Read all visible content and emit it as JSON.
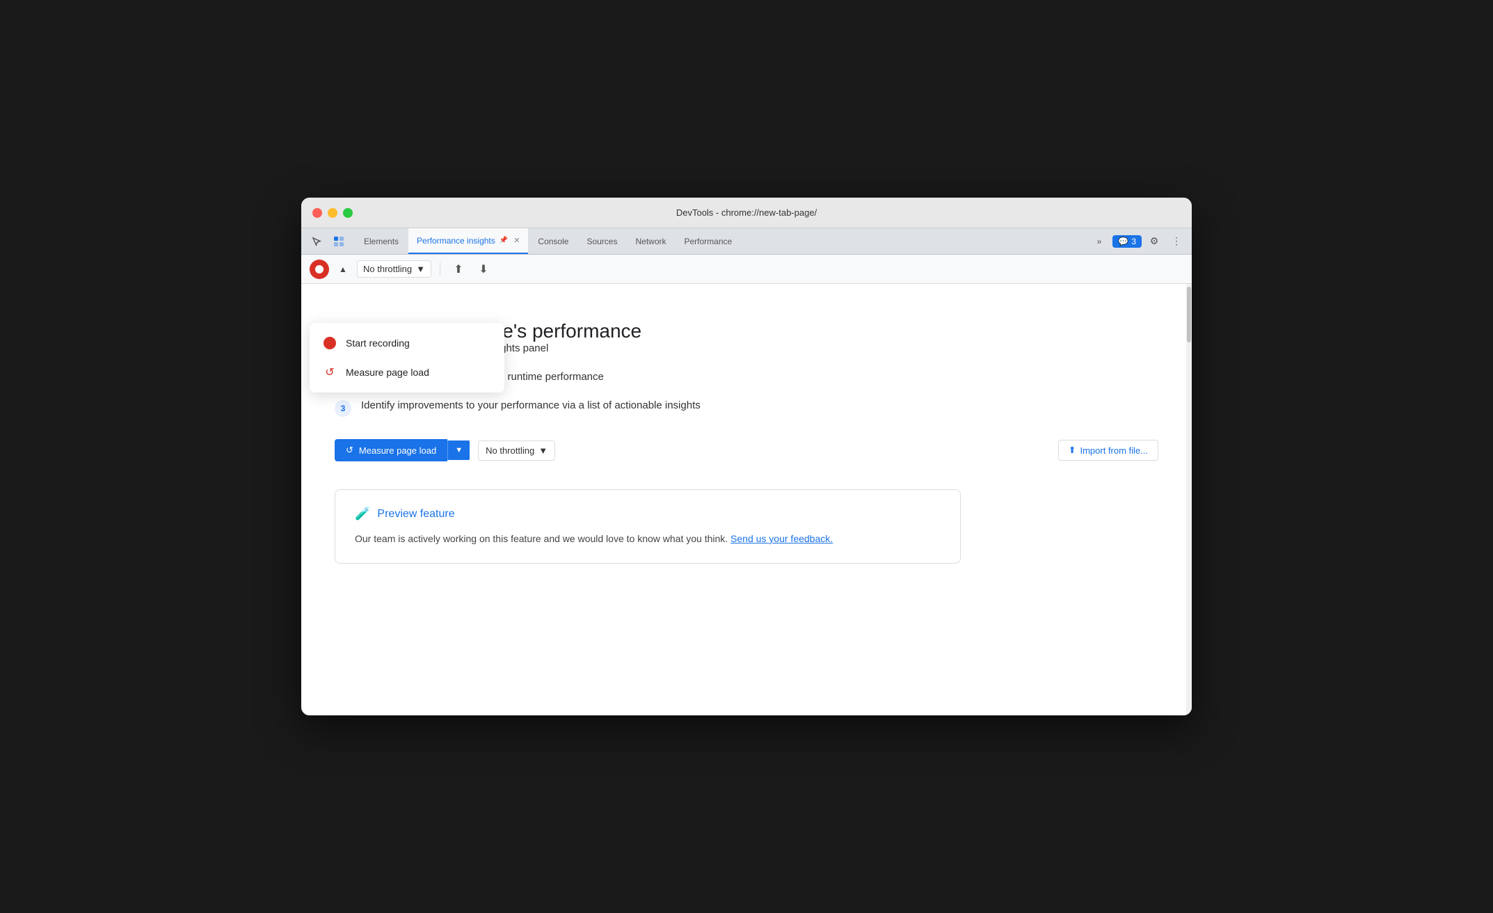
{
  "titlebar": {
    "title": "DevTools - chrome://new-tab-page/"
  },
  "tabs": [
    {
      "id": "elements",
      "label": "Elements",
      "active": false
    },
    {
      "id": "performance-insights",
      "label": "Performance insights",
      "active": true,
      "pinned": true,
      "closeable": true
    },
    {
      "id": "console",
      "label": "Console",
      "active": false
    },
    {
      "id": "sources",
      "label": "Sources",
      "active": false
    },
    {
      "id": "network",
      "label": "Network",
      "active": false
    },
    {
      "id": "performance",
      "label": "Performance",
      "active": false
    }
  ],
  "tabbar": {
    "more_label": "»",
    "chat_count": "3",
    "chat_icon": "💬"
  },
  "toolbar": {
    "throttle_label": "No throttling",
    "upload_icon": "⬆",
    "download_icon": "⬇"
  },
  "dropdown": {
    "items": [
      {
        "id": "start-recording",
        "label": "Start recording",
        "icon_type": "dot"
      },
      {
        "id": "measure-page-load",
        "label": "Measure page load",
        "icon_type": "reload"
      }
    ]
  },
  "main": {
    "heading_partial": "ghts on your website's performance",
    "step1_partial": "race into the Performance Insights panel",
    "step2": "Get an overview of your page's runtime performance",
    "step3": "Identify improvements to your performance via a list of actionable insights",
    "measure_btn": "Measure page load",
    "throttle_label": "No throttling",
    "import_label": "Import from file...",
    "preview": {
      "title": "Preview feature",
      "body": "Our team is actively working on this feature and we would love to know what you think.",
      "link_text": "Send us your feedback."
    }
  }
}
